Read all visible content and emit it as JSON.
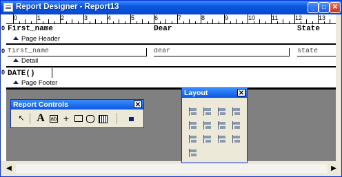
{
  "window": {
    "title": "Report Designer - Report13"
  },
  "ruler": {
    "labels": [
      "0",
      "1",
      "2",
      "3",
      "4",
      "5",
      "6",
      "7",
      "8",
      "9",
      "10",
      "11",
      "12",
      "13"
    ]
  },
  "bands": {
    "page_header": {
      "label": "Page Header",
      "marker": "0",
      "fields": [
        "First_name",
        "Dear",
        "State"
      ]
    },
    "detail": {
      "label": "Detail",
      "marker": "0",
      "fields": [
        "first_name",
        "dear",
        "state"
      ]
    },
    "page_footer": {
      "label": "Page Footer",
      "marker": "0",
      "fields": [
        "DATE()"
      ]
    }
  },
  "report_controls": {
    "title": "Report Controls",
    "close": "✕"
  },
  "layout": {
    "title": "Layout",
    "close": "✕"
  },
  "scrollbar": {
    "left": "◀",
    "right": "▶"
  },
  "title_buttons": {
    "minimize": "_",
    "maximize": "□",
    "close": "✕"
  },
  "colors": {
    "title_bar": "#0a58e0",
    "canvas": "#ffffff",
    "workspace": "#808080",
    "icon": "#0a246a"
  }
}
